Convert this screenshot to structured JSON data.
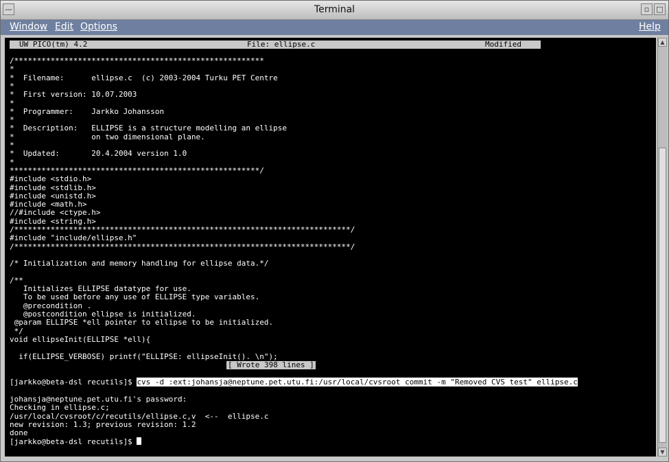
{
  "window": {
    "title": "Terminal",
    "minimize_glyph": "▫",
    "maximize_glyph": "□"
  },
  "menu": {
    "window": "Window",
    "edit": "Edit",
    "options": "Options",
    "help": "Help"
  },
  "pico_status": {
    "left": "UW PICO(tm) 4.2",
    "center": "File: ellipse.c",
    "right": "Modified"
  },
  "terminal_lines": [
    "/*******************************************************",
    "*",
    "*  Filename:      ellipse.c  (c) 2003-2004 Turku PET Centre",
    "*",
    "*  First version: 10.07.2003",
    "*",
    "*  Programmer:    Jarkko Johansson",
    "*",
    "*  Description:   ELLIPSE is a structure modelling an ellipse",
    "*                 on two dimensional plane.",
    "*",
    "*  Updated:       20.4.2004 version 1.0",
    "*",
    "*******************************************************/",
    "#include <stdio.h>",
    "#include <stdlib.h>",
    "#include <unistd.h>",
    "#include <math.h>",
    "//#include <ctype.h>",
    "#include <string.h>",
    "/**************************************************************************/",
    "#include \"include/ellipse.h\"",
    "/**************************************************************************/",
    "",
    "/* Initialization and memory handling for ellipse data.*/",
    "",
    "/**",
    "   Initializes ELLIPSE datatype for use.",
    "   To be used before any use of ELLIPSE type variables.",
    "   @precondition .",
    "   @postcondition ellipse is initialized.",
    " @param ELLIPSE *ell pointer to ellipse to be initialized.",
    " */",
    "void ellipseInit(ELLIPSE *ell){",
    "",
    "  if(ELLIPSE_VERBOSE) printf(\"ELLIPSE: ellipseInit(). \\n\");"
  ],
  "wrote_message": "[ Wrote 398 lines ]",
  "shell": {
    "prompt": "[jarkko@beta-dsl recutils]$ ",
    "command": "cvs -d :ext:johansja@neptune.pet.utu.fi:/usr/local/cvsroot commit -m \"Removed CVS test\" ellipse.c",
    "output": [
      "johansja@neptune.pet.utu.fi's password:",
      "Checking in ellipse.c;",
      "/usr/local/cvsroot/c/recutils/ellipse.c,v  <--  ellipse.c",
      "new revision: 1.3; previous revision: 1.2",
      "done"
    ],
    "final_prompt": "[jarkko@beta-dsl recutils]$ "
  }
}
